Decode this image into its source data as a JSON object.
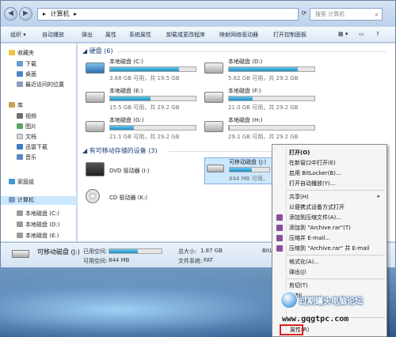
{
  "address": {
    "root_arrow": "▸",
    "path": "计算机",
    "arrow": "▸"
  },
  "search": {
    "placeholder": "搜索 计算机"
  },
  "toolbar": {
    "organize": "组织 ▾",
    "autoplay": "自动播放",
    "eject": "弹出",
    "properties": "属性",
    "system_properties": "系统属性",
    "uninstall": "卸载或更改程序",
    "map_drive": "映射网络驱动器",
    "control_panel": "打开控制面板"
  },
  "sidebar": {
    "favorites": "收藏夹",
    "downloads": "下载",
    "desktop": "桌面",
    "recent": "最近访问的位置",
    "library": "库",
    "videos": "视频",
    "pictures": "图片",
    "documents": "文档",
    "xunlei": "迅雷下载",
    "music": "音乐",
    "homegroup": "家庭组",
    "computer": "计算机",
    "disk_c": "本地磁盘 (C:)",
    "disk_d": "本地磁盘 (D:)",
    "disk_e": "本地磁盘 (E:)"
  },
  "groups": {
    "hard_disks": "硬盘 (6)",
    "removable": "有可移动存储的设备 (3)"
  },
  "drives": [
    {
      "name": "本地磁盘 (C:)",
      "free": "3.68 GB 可用，共 19.5 GB",
      "used_fraction": 0.81
    },
    {
      "name": "本地磁盘 (D:)",
      "free": "5.62 GB 可用，共 29.2 GB",
      "used_fraction": 0.81
    },
    {
      "name": "本地磁盘 (E:)",
      "free": "15.5 GB 可用，共 29.2 GB",
      "used_fraction": 0.47
    },
    {
      "name": "本地磁盘 (F:)",
      "free": "21.0 GB 可用，共 29.2 GB",
      "used_fraction": 0.28
    },
    {
      "name": "本地磁盘 (G:)",
      "free": "21.1 GB 可用，共 29.2 GB",
      "used_fraction": 0.28
    },
    {
      "name": "本地磁盘 (H:)",
      "free": "29.1 GB 可用，共 29.2 GB",
      "used_fraction": 0.01
    }
  ],
  "removable": {
    "dvd": "DVD 驱动器 (I:)",
    "cd": "CD 驱动器 (K:)",
    "usb_name": "可移动磁盘 (J:)",
    "usb_free": "844 MB 可用，",
    "usb_used_fraction": 0.55
  },
  "details": {
    "name": "可移动磁盘 (J:)",
    "used_label": "已用空间:",
    "free_label": "可用空间:",
    "free_value": "844 MB",
    "total_label": "总大小:",
    "total_value": "1.87 GB",
    "fs_label": "文件系统:",
    "fs_value": "FAT",
    "bitlocker_label": "BitL"
  },
  "context_menu": {
    "open": "打开(O)",
    "open_new_window": "在新窗口中打开(E)",
    "enable_bitlocker": "启用 BitLocker(B)...",
    "open_autoplay": "打开自动播放(Y)...",
    "share": "共享(H)",
    "portable_open": "以便携式设备方式打开",
    "add_archive": "添加到压缩文件(A)...",
    "add_archive_rar": "添加到 \"Archive.rar\"(T)",
    "compress_email": "压缩并 E-mail...",
    "compress_rar_email": "压缩到 \"Archive.rar\" 并 E-mail",
    "format": "格式化(A)...",
    "eject": "弹出(J)",
    "cut": "剪切(T)",
    "copy": "复制(",
    "properties": "属性(R)"
  },
  "watermark": {
    "forum": "过期罐头电脑论坛",
    "url": "www.gqgtpc.com"
  },
  "colors": {
    "selection": "#cce8ff",
    "bar_fill": "#26a0da",
    "highlight_box": "#dd2222"
  }
}
